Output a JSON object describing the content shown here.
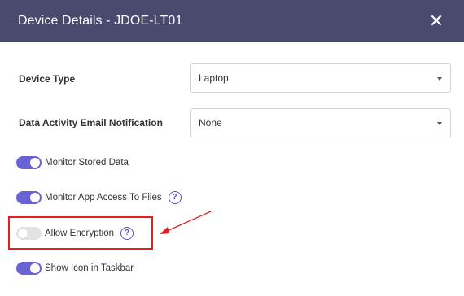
{
  "dialog": {
    "title": "Device Details - JDOE-LT01",
    "close_glyph": "✕"
  },
  "fields": {
    "device_type": {
      "label": "Device Type",
      "value": "Laptop"
    },
    "email_notification": {
      "label": "Data Activity Email Notification",
      "value": "None"
    }
  },
  "toggles": [
    {
      "label": "Monitor Stored Data",
      "state": "on",
      "has_help": false
    },
    {
      "label": "Monitor App Access To Files",
      "state": "on",
      "has_help": true
    },
    {
      "label": "Allow Encryption",
      "state": "off",
      "has_help": true
    },
    {
      "label": "Show Icon in Taskbar",
      "state": "on",
      "has_help": false
    }
  ],
  "help_glyph": "?",
  "colors": {
    "header_bg": "#4a4a6e",
    "toggle_on": "#6a63d4",
    "toggle_off": "#e3e3e6",
    "highlight": "#e02020"
  }
}
